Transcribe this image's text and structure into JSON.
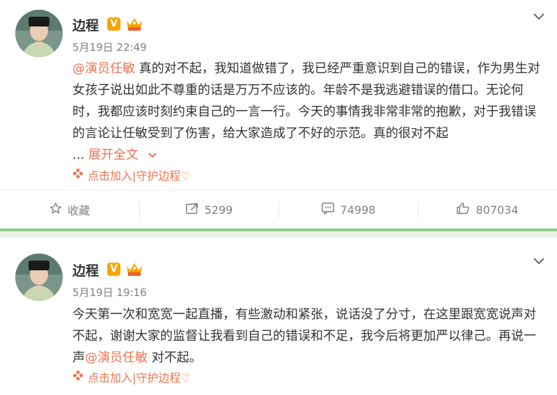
{
  "colors": {
    "accent": "#eb7350",
    "vip": "#f7a400",
    "divider": "#8fd08a"
  },
  "posts": [
    {
      "author": "边程",
      "verified_badge": "V",
      "time": "5月19日 22:49",
      "mention": "@演员任敏",
      "text": " 真的对不起，我知道做错了，我已经严重意识到自己的错误，作为男生对女孩子说出如此不尊重的话是万万不应该的。年龄不是我逃避错误的借口。无论何时，我都应该时刻约束自己的一言一行。今天的事情我非常非常的抱歉，对于我错误的言论让任敏受到了伤害，给大家造成了不好的示范。真的很对不起",
      "ellipsis": "...",
      "expand_label": "展开全文",
      "guard_label": "点击加入|守护边程♡",
      "actions": {
        "favorite_label": "收藏",
        "repost_count": "5299",
        "comment_count": "74998",
        "like_count": "807034"
      }
    },
    {
      "author": "边程",
      "verified_badge": "V",
      "time": "5月19日 19:16",
      "text_before": "今天第一次和宽宽一起直播，有些激动和紧张，说话没了分寸，在这里跟宽宽说声对不起，谢谢大家的监督让我看到自己的错误和不足，我今后将更加严以律己。再说一声",
      "mention": "@演员任敏",
      "text_after": " 对不起。",
      "guard_label": "点击加入|守护边程♡"
    }
  ]
}
